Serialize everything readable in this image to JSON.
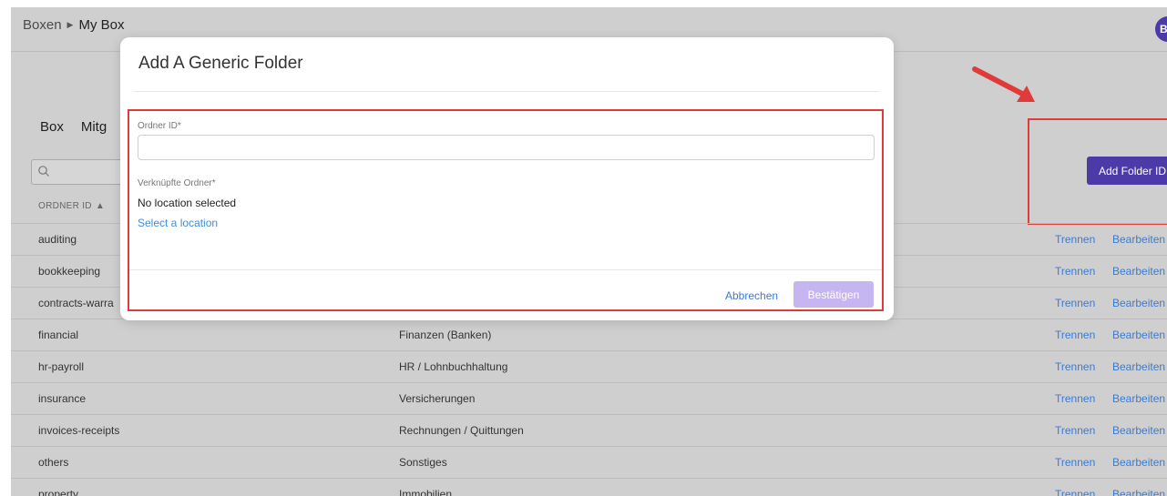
{
  "breadcrumb": {
    "root": "Boxen",
    "current": "My Box"
  },
  "user": {
    "avatar_initial": "B"
  },
  "tabs": [
    "Box",
    "Mitg"
  ],
  "search": {
    "placeholder": ""
  },
  "toolbar": {
    "add_folder_label": "Add Folder ID"
  },
  "table": {
    "column_header": "ORDNER ID",
    "sort_icon": "sort-ascending-icon",
    "rows": [
      {
        "id": "auditing",
        "name": "",
        "action1": "Trennen",
        "action2": "Bearbeiten"
      },
      {
        "id": "bookkeeping",
        "name": "",
        "action1": "Trennen",
        "action2": "Bearbeiten"
      },
      {
        "id": "contracts-warra",
        "name": "",
        "action1": "Trennen",
        "action2": "Bearbeiten"
      },
      {
        "id": "financial",
        "name": "Finanzen (Banken)",
        "action1": "Trennen",
        "action2": "Bearbeiten"
      },
      {
        "id": "hr-payroll",
        "name": "HR / Lohnbuchhaltung",
        "action1": "Trennen",
        "action2": "Bearbeiten"
      },
      {
        "id": "insurance",
        "name": "Versicherungen",
        "action1": "Trennen",
        "action2": "Bearbeiten"
      },
      {
        "id": "invoices-receipts",
        "name": "Rechnungen / Quittungen",
        "action1": "Trennen",
        "action2": "Bearbeiten"
      },
      {
        "id": "others",
        "name": "Sonstiges",
        "action1": "Trennen",
        "action2": "Bearbeiten"
      },
      {
        "id": "property",
        "name": "Immobilien",
        "action1": "Trennen",
        "action2": "Bearbeiten"
      }
    ]
  },
  "modal": {
    "title": "Add A Generic Folder",
    "folder_id_label": "Ordner ID*",
    "folder_id_value": "",
    "linked_label": "Verknüpfte Ordner*",
    "no_location": "No location selected",
    "select_location": "Select a location",
    "cancel_label": "Abbrechen",
    "confirm_label": "Bestätigen"
  },
  "colors": {
    "accent": "#4b3aa8",
    "link": "#3a7bd5",
    "highlight": "#e03b3b",
    "overlay": "#cfcfcf",
    "confirm_disabled": "#c5b5f0"
  }
}
